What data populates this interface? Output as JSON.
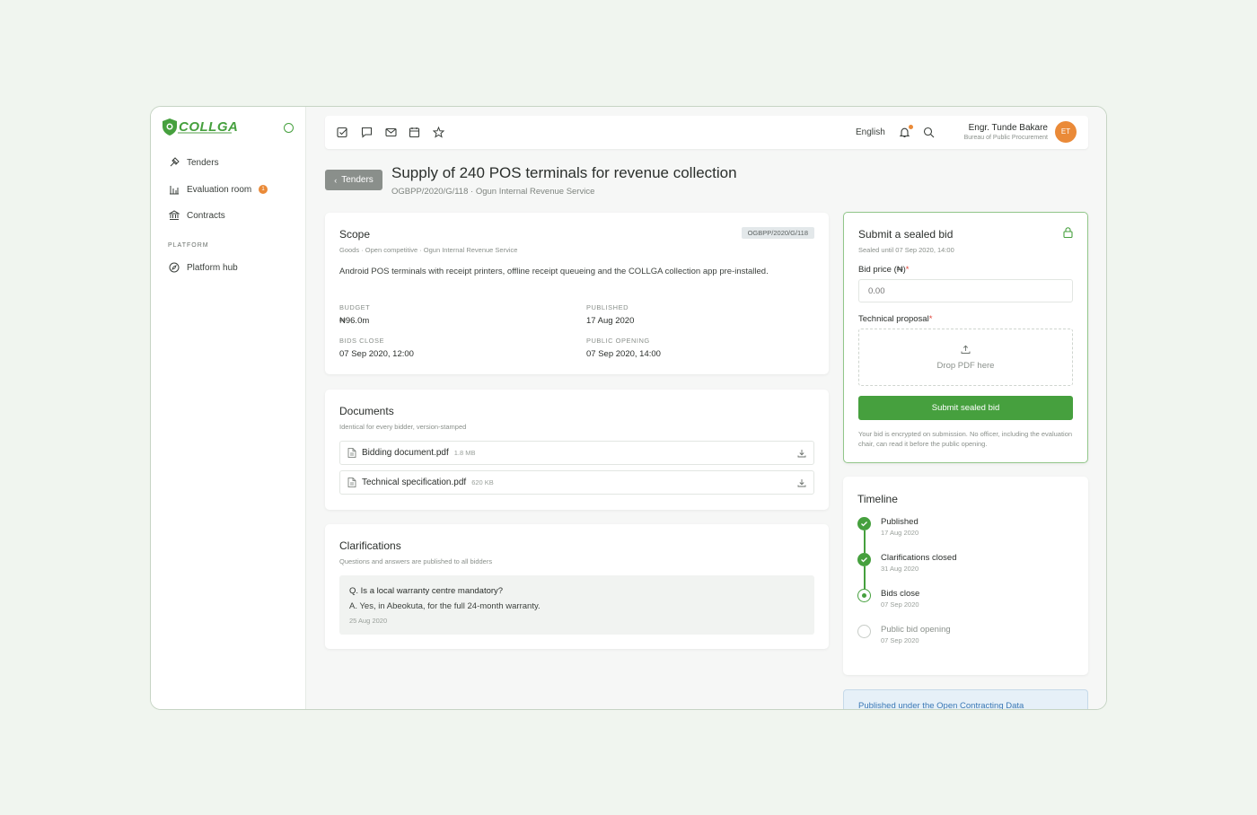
{
  "app": {
    "logo_text": "COLLGA",
    "accent_color": "#46a03e"
  },
  "sidebar": {
    "items": [
      {
        "label": "Tenders",
        "icon": "gavel-icon"
      },
      {
        "label": "Evaluation room",
        "icon": "bar-chart-icon",
        "badge": "1"
      },
      {
        "label": "Contracts",
        "icon": "bank-icon"
      }
    ],
    "section_label": "PLATFORM",
    "platform_items": [
      {
        "label": "Platform hub",
        "icon": "compass-icon"
      }
    ]
  },
  "topbar": {
    "icons": [
      "checkbox-icon",
      "chat-icon",
      "mail-icon",
      "calendar-icon",
      "star-icon"
    ],
    "language": "English",
    "user_name": "Engr. Tunde Bakare",
    "user_org": "Bureau of Public Procurement",
    "avatar_initials": "ET"
  },
  "header": {
    "back_label": "Tenders",
    "title": "Supply of 240 POS terminals for revenue collection",
    "subtitle": "OGBPP/2020/G/118 · Ogun Internal Revenue Service"
  },
  "scope": {
    "title": "Scope",
    "subtitle": "Goods · Open competitive · Ogun Internal Revenue Service",
    "tag": "OGBPP/2020/G/118",
    "description": "Android POS terminals with receipt printers, offline receipt queueing and the COLLGA collection app pre-installed.",
    "budget_label": "BUDGET",
    "budget_value": "₦96.0m",
    "published_label": "PUBLISHED",
    "published_value": "17 Aug 2020",
    "bids_close_label": "BIDS CLOSE",
    "bids_close_value": "07 Sep 2020, 12:00",
    "public_opening_label": "PUBLIC OPENING",
    "public_opening_value": "07 Sep 2020, 14:00"
  },
  "documents": {
    "title": "Documents",
    "subtitle": "Identical for every bidder, version-stamped",
    "files": [
      {
        "name": "Bidding document.pdf",
        "size": "1.8 MB"
      },
      {
        "name": "Technical specification.pdf",
        "size": "620 KB"
      }
    ]
  },
  "clarifications": {
    "title": "Clarifications",
    "subtitle": "Questions and answers are published to all bidders",
    "question": "Q. Is a local warranty centre mandatory?",
    "answer": "A. Yes, in Abeokuta, for the full 24-month warranty.",
    "date": "25 Aug 2020"
  },
  "bid": {
    "title": "Submit a sealed bid",
    "subtitle": "Sealed until 07 Sep 2020, 14:00",
    "price_label": "Bid price (₦)",
    "price_placeholder": "0.00",
    "proposal_label": "Technical proposal",
    "dropzone_text": "Drop PDF here",
    "submit_label": "Submit sealed bid",
    "note": "Your bid is encrypted on submission. No officer, including the evaluation chair, can read it before the public opening."
  },
  "timeline": {
    "title": "Timeline",
    "steps": [
      {
        "name": "Published",
        "date": "17 Aug 2020",
        "state": "done"
      },
      {
        "name": "Clarifications closed",
        "date": "31 Aug 2020",
        "state": "done"
      },
      {
        "name": "Bids close",
        "date": "07 Sep 2020",
        "state": "current"
      },
      {
        "name": "Public bid opening",
        "date": "07 Sep 2020",
        "state": "pending"
      }
    ]
  },
  "ocds": {
    "text": "Published under the Open Contracting Data"
  }
}
